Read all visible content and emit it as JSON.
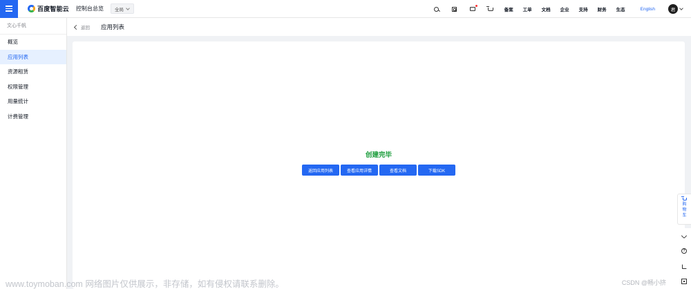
{
  "topbar": {
    "logo_text": "百度智能云",
    "console_label": "控制台总览",
    "region_value": "全局",
    "nav_items": [
      "备案",
      "工单",
      "文档",
      "企业",
      "支持",
      "财务",
      "生态"
    ],
    "language_label": "English",
    "avatar_text": "君"
  },
  "sidebar": {
    "title": "文心千帆",
    "items": [
      "概览",
      "应用列表",
      "资源租赁",
      "权限管理",
      "用量统计",
      "计费管理"
    ],
    "active_index": 1
  },
  "header": {
    "back_label": "返回",
    "page_title": "应用列表"
  },
  "main": {
    "status_title": "创建完毕",
    "buttons": [
      "返回应用列表",
      "查看应用详情",
      "查看文档",
      "下载SDK"
    ]
  },
  "float_tools": {
    "cart_label": "购物车"
  },
  "watermark": {
    "text": "www.toymoban.com 网络图片仅供展示，非存储，如有侵权请联系删除。",
    "csdn_text": "CSDN @畅小挤"
  },
  "colors": {
    "accent": "#2468f2",
    "success": "#1e9e3e",
    "page_bg": "#f0f2f5"
  }
}
